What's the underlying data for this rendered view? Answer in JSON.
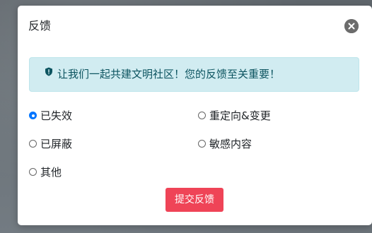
{
  "modal": {
    "title": "反馈",
    "close_icon": "close-icon",
    "alert": {
      "icon": "shield-exclamation-icon",
      "text": "让我们一起共建文明社区！您的反馈至关重要！"
    },
    "options": [
      {
        "label": "已失效",
        "checked": true
      },
      {
        "label": "重定向&变更",
        "checked": false
      },
      {
        "label": "已屏蔽",
        "checked": false
      },
      {
        "label": "敏感内容",
        "checked": false
      },
      {
        "label": "其他",
        "checked": false
      }
    ],
    "submit_label": "提交反馈"
  },
  "colors": {
    "alert_bg": "#d1ecf1",
    "alert_text": "#0c5460",
    "submit_bg": "#ef4457",
    "radio_checked": "#0075ff"
  }
}
